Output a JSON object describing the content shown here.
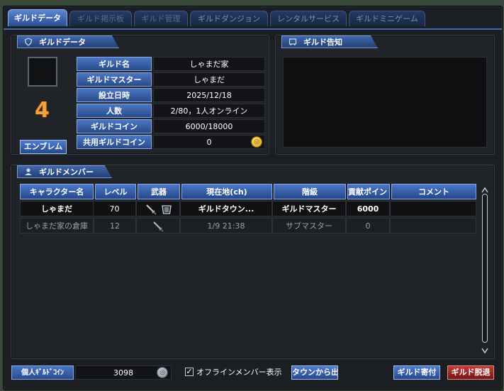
{
  "tabs": [
    {
      "label": "ギルドデータ",
      "state": "active"
    },
    {
      "label": "ギルド掲示板",
      "state": "disabled"
    },
    {
      "label": "ギルド管理",
      "state": "disabled"
    },
    {
      "label": "ギルドダンジョン",
      "state": "normal"
    },
    {
      "label": "レンタルサービス",
      "state": "normal"
    },
    {
      "label": "ギルドミニゲーム",
      "state": "normal"
    }
  ],
  "guild_data": {
    "section_title": "ギルドデータ",
    "level": "4",
    "emblem_button": "エンブレム",
    "fields": [
      {
        "label": "ギルド名",
        "value": "しゃまだ家"
      },
      {
        "label": "ギルドマスター",
        "value": "しゃまだ"
      },
      {
        "label": "設立日時",
        "value": "2025/12/18"
      },
      {
        "label": "人数",
        "value": "2/80，1人オンライン"
      },
      {
        "label": "ギルドコイン",
        "value": "6000/18000"
      },
      {
        "label": "共用ギルドコイン",
        "value": "0"
      }
    ]
  },
  "notice": {
    "section_title": "ギルド告知"
  },
  "members": {
    "section_title": "ギルドメンバー",
    "columns": [
      "キャラクター名",
      "レベル",
      "武器",
      "現在地(ch)",
      "階級",
      "貢献ポイント",
      "コメント"
    ],
    "rows": [
      {
        "name": "しゃまだ",
        "level": "70",
        "location": "ギルドタウン...",
        "rank": "ギルドマスター",
        "points": "6000",
        "comment": "",
        "online": true
      },
      {
        "name": "しゃまだ家の倉庫",
        "level": "12",
        "location": "1/9 21:38",
        "rank": "サブマスター",
        "points": "0",
        "comment": "",
        "online": false
      }
    ]
  },
  "footer": {
    "personal_coin_label": "個人ｷﾞﾙﾄﾞｺｲﾝ",
    "personal_coin_value": "3098",
    "offline_label": "オフラインメンバー表示",
    "town_exit_button": "タウンから出る",
    "donate_button": "ギルド寄付",
    "leave_button": "ギルド脱退"
  },
  "colors": {
    "accent": "#3f67ad",
    "danger": "#a52724",
    "level": "#f0a23c"
  }
}
